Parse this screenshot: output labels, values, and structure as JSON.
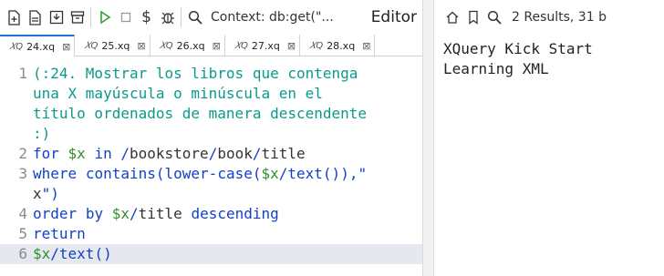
{
  "toolbar": {
    "context_label": "Context: db:get(\"...",
    "pane_title": "Editor",
    "icons": [
      "new-file-icon",
      "open-file-icon",
      "save-icon",
      "archive-icon",
      "run-icon",
      "stop-icon",
      "dollar-icon",
      "debug-bug-icon",
      "search-icon"
    ]
  },
  "tabs": [
    {
      "label": "24.xq",
      "active": true
    },
    {
      "label": "25.xq",
      "active": false
    },
    {
      "label": "26.xq",
      "active": false
    },
    {
      "label": "27.xq",
      "active": false
    },
    {
      "label": "28.xq",
      "active": false
    }
  ],
  "editor": {
    "line_numbers": [
      "1",
      "",
      "",
      "",
      "2",
      "3",
      "",
      "4",
      "5",
      "6"
    ],
    "lines": [
      "(:24. Mostrar los libros que contenga",
      "una X mayúscula o minúscula en el",
      "título ordenados de manera descendente",
      ":)",
      "for $x in /bookstore/book/title",
      "where contains(lower-case($x/text()),\"",
      "x\")",
      "order by $x/title descending",
      "return",
      "$x/text()"
    ]
  },
  "result": {
    "status": "2 Results, 31 b",
    "output": "XQuery Kick Start\nLearning XML",
    "icons": [
      "home-icon",
      "bookmark-icon",
      "search-icon"
    ]
  }
}
